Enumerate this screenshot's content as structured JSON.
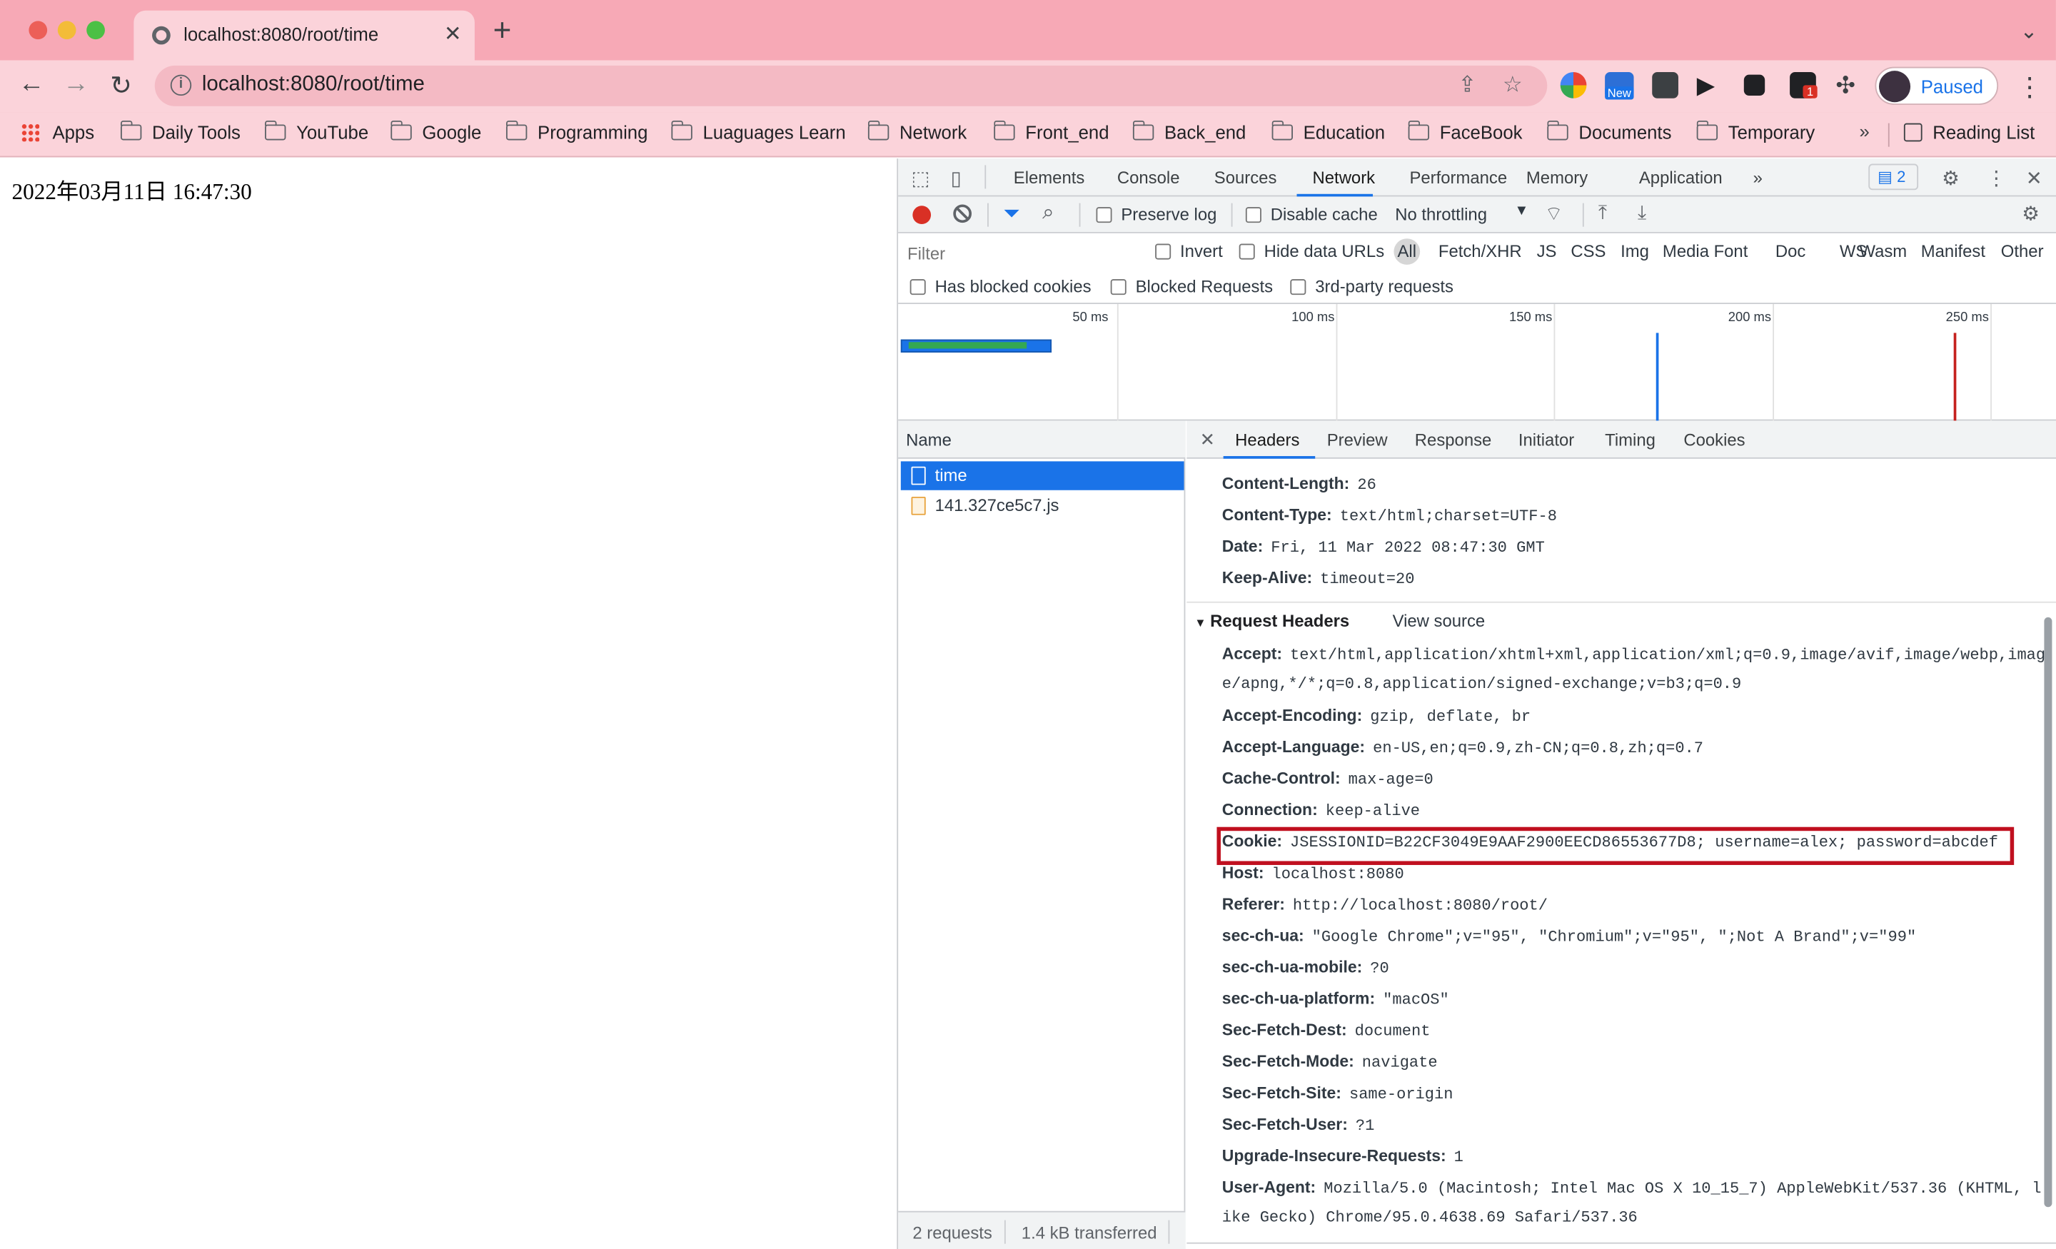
{
  "browser": {
    "tab_title": "localhost:8080/root/time",
    "url": "localhost:8080/root/time",
    "profile_label": "Paused",
    "ext_new_badge": "New",
    "ext_count_badge": "1",
    "bookmarks": [
      {
        "label": "Apps",
        "icon": "apps-grid-icon"
      },
      {
        "label": "Daily Tools",
        "icon": "folder-icon"
      },
      {
        "label": "YouTube",
        "icon": "folder-icon"
      },
      {
        "label": "Google",
        "icon": "folder-icon"
      },
      {
        "label": "Programming",
        "icon": "folder-icon"
      },
      {
        "label": "Luaguages Learn",
        "icon": "folder-icon"
      },
      {
        "label": "Network",
        "icon": "folder-icon"
      },
      {
        "label": "Front_end",
        "icon": "folder-icon"
      },
      {
        "label": "Back_end",
        "icon": "folder-icon"
      },
      {
        "label": "Education",
        "icon": "folder-icon"
      },
      {
        "label": "FaceBook",
        "icon": "folder-icon"
      },
      {
        "label": "Documents",
        "icon": "folder-icon"
      },
      {
        "label": "Temporary",
        "icon": "folder-icon"
      }
    ],
    "bookmarks_more": "»",
    "reading_list": "Reading List"
  },
  "page": {
    "time_text": "2022年03月11日 16:47:30"
  },
  "devtools": {
    "tabs": [
      "Elements",
      "Console",
      "Sources",
      "Network",
      "Performance",
      "Memory",
      "Application"
    ],
    "active_tab": "Network",
    "more_tabs": "»",
    "issues_count": "2",
    "toolbar": {
      "preserve_log": "Preserve log",
      "disable_cache": "Disable cache",
      "throttling": "No throttling"
    },
    "filter": {
      "placeholder": "Filter",
      "invert": "Invert",
      "hide_data_urls": "Hide data URLs",
      "types": [
        "All",
        "Fetch/XHR",
        "JS",
        "CSS",
        "Img",
        "Media",
        "Font",
        "Doc",
        "WS",
        "Wasm",
        "Manifest",
        "Other"
      ],
      "has_blocked_cookies": "Has blocked cookies",
      "blocked_requests": "Blocked Requests",
      "third_party": "3rd-party requests"
    },
    "overview_ticks": [
      "50 ms",
      "100 ms",
      "150 ms",
      "200 ms",
      "250 ms"
    ],
    "requests": {
      "column": "Name",
      "items": [
        {
          "name": "time",
          "type": "document",
          "selected": true
        },
        {
          "name": "141.327ce5c7.js",
          "type": "script",
          "selected": false
        }
      ],
      "summary_requests": "2 requests",
      "summary_transferred": "1.4 kB transferred"
    },
    "detail": {
      "tabs": [
        "Headers",
        "Preview",
        "Response",
        "Initiator",
        "Timing",
        "Cookies"
      ],
      "active_tab": "Headers",
      "response_headers": [
        {
          "name": "Content-Length:",
          "value": "26"
        },
        {
          "name": "Content-Type:",
          "value": "text/html;charset=UTF-8"
        },
        {
          "name": "Date:",
          "value": "Fri, 11 Mar 2022 08:47:30 GMT"
        },
        {
          "name": "Keep-Alive:",
          "value": "timeout=20"
        }
      ],
      "request_section_title": "Request Headers",
      "view_source": "View source",
      "request_headers": [
        {
          "name": "Accept:",
          "value": "text/html,application/xhtml+xml,application/xml;q=0.9,image/avif,image/webp,imag",
          "cont": "e/apng,*/*;q=0.8,application/signed-exchange;v=b3;q=0.9"
        },
        {
          "name": "Accept-Encoding:",
          "value": "gzip, deflate, br"
        },
        {
          "name": "Accept-Language:",
          "value": "en-US,en;q=0.9,zh-CN;q=0.8,zh;q=0.7"
        },
        {
          "name": "Cache-Control:",
          "value": "max-age=0"
        },
        {
          "name": "Connection:",
          "value": "keep-alive"
        },
        {
          "name": "Cookie:",
          "value": "JSESSIONID=B22CF3049E9AAF2900EECD86553677D8; username=alex; password=abcdef",
          "highlight": true
        },
        {
          "name": "Host:",
          "value": "localhost:8080"
        },
        {
          "name": "Referer:",
          "value": "http://localhost:8080/root/"
        },
        {
          "name": "sec-ch-ua:",
          "value": "\"Google Chrome\";v=\"95\", \"Chromium\";v=\"95\", \";Not A Brand\";v=\"99\""
        },
        {
          "name": "sec-ch-ua-mobile:",
          "value": "?0"
        },
        {
          "name": "sec-ch-ua-platform:",
          "value": "\"macOS\""
        },
        {
          "name": "Sec-Fetch-Dest:",
          "value": "document"
        },
        {
          "name": "Sec-Fetch-Mode:",
          "value": "navigate"
        },
        {
          "name": "Sec-Fetch-Site:",
          "value": "same-origin"
        },
        {
          "name": "Sec-Fetch-User:",
          "value": "?1"
        },
        {
          "name": "Upgrade-Insecure-Requests:",
          "value": "1"
        },
        {
          "name": "User-Agent:",
          "value": "Mozilla/5.0 (Macintosh; Intel Mac OS X 10_15_7) AppleWebKit/537.36 (KHTML, l",
          "cont": "ike Gecko) Chrome/95.0.4638.69 Safari/537.36"
        }
      ]
    }
  },
  "colors": {
    "chrome_frame": "#f7a9b6",
    "chrome_toolbar": "#fbd3da",
    "accent": "#1a73e8",
    "record": "#d93025",
    "highlight_box": "#c0101f"
  }
}
